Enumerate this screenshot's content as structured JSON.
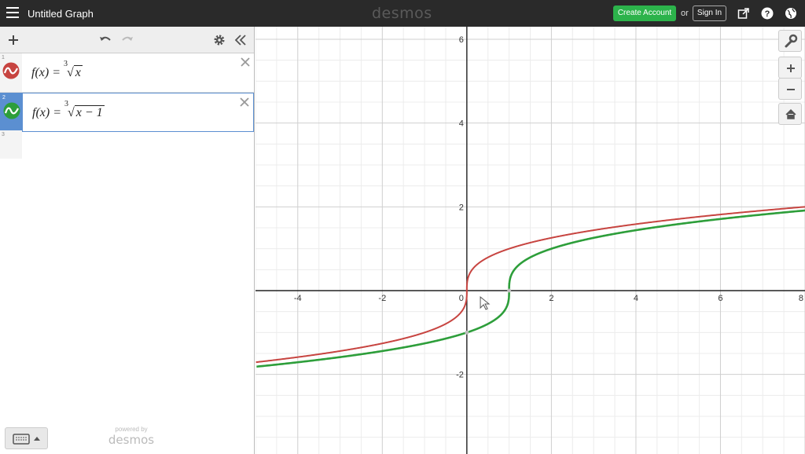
{
  "header": {
    "title": "Untitled Graph",
    "brand": "desmos",
    "create_account": "Create Account",
    "or": "or",
    "sign_in": "Sign In"
  },
  "expressions": [
    {
      "num": "1",
      "color": "#c74440",
      "prefix": "f(x) = ",
      "index": "3",
      "radicand": "x"
    },
    {
      "num": "2",
      "color": "#2d9e3a",
      "prefix": "f(x) = ",
      "index": "3",
      "radicand": "x − 1"
    }
  ],
  "empty_row_num": "3",
  "footer": {
    "powered_small": "powered by",
    "powered_big": "desmos"
  },
  "icons": [
    "menu-icon",
    "share-icon",
    "help-icon",
    "globe-icon",
    "add-icon",
    "undo-icon",
    "redo-icon",
    "settings-icon",
    "collapse-icon",
    "close-icon",
    "keyboard-icon",
    "wrench-icon",
    "zoom-in-icon",
    "zoom-out-icon",
    "home-icon"
  ],
  "chart_data": {
    "type": "line",
    "xlim": [
      -5,
      8
    ],
    "ylim": [
      -3.9,
      6.3
    ],
    "x_ticks": [
      -4,
      -2,
      0,
      2,
      4,
      6,
      8
    ],
    "y_ticks": [
      -2,
      2,
      4,
      6
    ],
    "x_tick_labels": [
      "-4",
      "-2",
      "0",
      "2",
      "4",
      "6",
      "8"
    ],
    "y_tick_labels": [
      "-2",
      "2",
      "4",
      "6"
    ],
    "grid": true,
    "series": [
      {
        "color": "#c74440",
        "function": "cbrt(x)"
      },
      {
        "color": "#2d9e3a",
        "function": "cbrt(x-1)"
      }
    ]
  }
}
